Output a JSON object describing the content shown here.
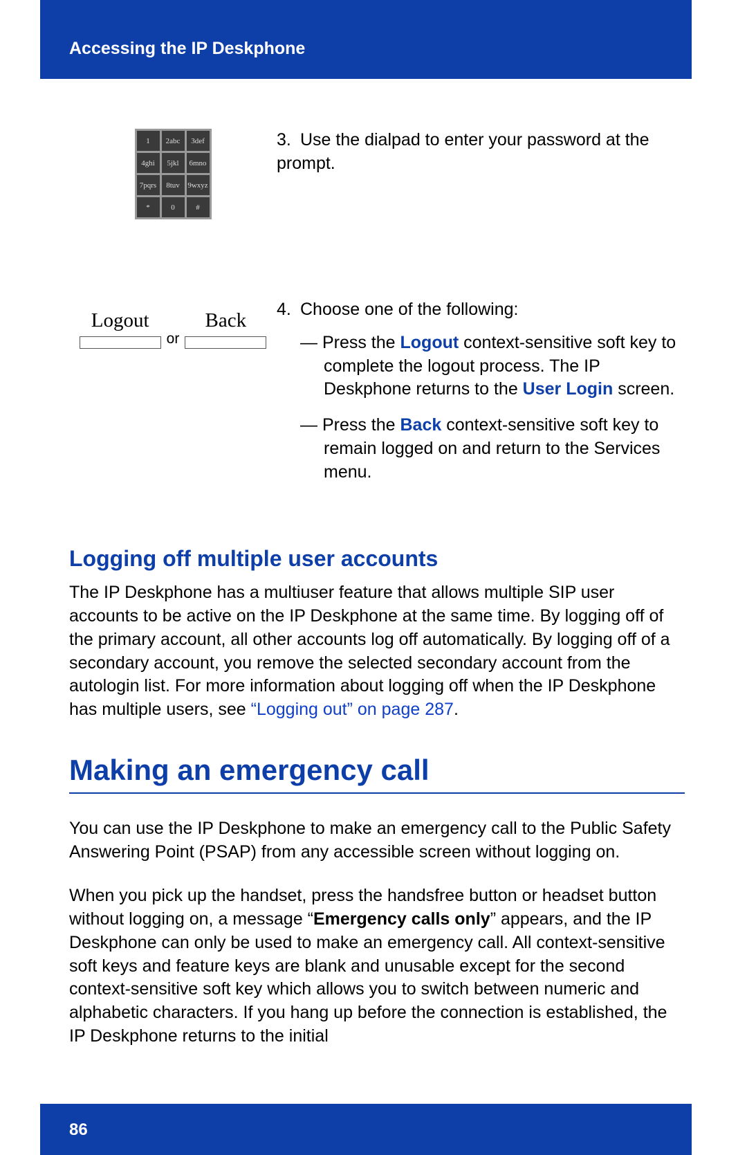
{
  "header": {
    "title": "Accessing the IP Deskphone"
  },
  "dialpad": {
    "keys": [
      "1",
      "2abc",
      "3def",
      "4ghi",
      "5jkl",
      "6mno",
      "7pqrs",
      "8tuv",
      "9wxyz",
      "*",
      "0",
      "#"
    ]
  },
  "step3": {
    "num": "3.",
    "text": "Use the dialpad to enter your password at the prompt."
  },
  "softkeys": {
    "logout_label": "Logout",
    "back_label": "Back",
    "or": "or"
  },
  "step4": {
    "num": "4.",
    "intro": "Choose one of the following:",
    "item1_pre": "— Press the ",
    "item1_key": "Logout",
    "item1_mid": " context-sensitive soft key to complete the logout process. The IP Deskphone returns to the ",
    "item1_login": "User Login",
    "item1_post": " screen.",
    "item2_pre": "— Press the ",
    "item2_key": "Back",
    "item2_post": " context-sensitive soft key to remain logged on and return to the Services menu."
  },
  "sec1": {
    "heading": "Logging off multiple user accounts",
    "para_pre": "The IP Deskphone has a multiuser feature that allows multiple SIP user accounts to be active on the IP Deskphone at the same time. By logging off of the primary account, all other accounts log off automatically. By logging off of a secondary account, you remove the selected secondary account from the autologin list. For more information about logging off when the IP Deskphone has multiple users, see ",
    "link": "“Logging out” on page 287",
    "para_post": "."
  },
  "sec2": {
    "heading": "Making an emergency call",
    "para1": "You can use the IP Deskphone to make an emergency call to the Public Safety Answering Point (PSAP) from any accessible screen without logging on.",
    "para2_pre": "When you pick up the handset, press the handsfree button or headset button without logging on, a message “",
    "para2_bold": "Emergency calls only",
    "para2_post": "” appears, and the IP Deskphone can only be used to make an emergency call. All context-sensitive soft keys and feature keys are blank and unusable except for the second context-sensitive soft key which allows you to switch between numeric and alphabetic characters. If you hang up before the connection is established, the IP Deskphone returns to the initial"
  },
  "footer": {
    "page": "86"
  }
}
